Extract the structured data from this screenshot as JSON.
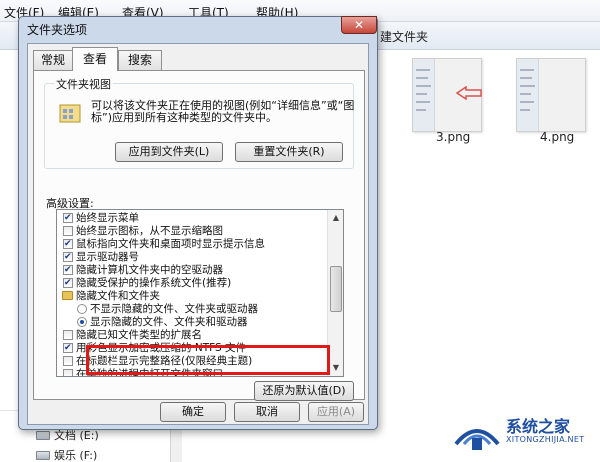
{
  "explorer": {
    "menu": [
      "文件(F)",
      "编辑(E)",
      "查看(V)",
      "工具(T)",
      "帮助(H)"
    ],
    "new_folder_label": "建文件夹",
    "files": [
      {
        "name": "3.png",
        "icon": "image-thumbnail"
      },
      {
        "name": "4.png",
        "icon": "image-thumbnail"
      }
    ],
    "drives": [
      {
        "label": "文档 (E:)",
        "icon": "drive-icon"
      },
      {
        "label": "娱乐 (F:)",
        "icon": "drive-icon"
      }
    ]
  },
  "dialog": {
    "title": "文件夹选项",
    "close_label": "✕",
    "tabs": [
      {
        "label": "常规",
        "active": false
      },
      {
        "label": "查看",
        "active": true
      },
      {
        "label": "搜索",
        "active": false
      }
    ],
    "folder_views": {
      "group_label": "文件夹视图",
      "description": "可以将该文件夹正在使用的视图(例如“详细信息”或“图标”)应用到所有这种类型的文件夹中。",
      "apply_button": "应用到文件夹(L)",
      "reset_button": "重置文件夹(R)"
    },
    "advanced_label": "高级设置:",
    "advanced_items": [
      {
        "type": "checkbox",
        "checked": true,
        "label": "始终显示菜单"
      },
      {
        "type": "checkbox",
        "checked": false,
        "label": "始终显示图标，从不显示缩略图"
      },
      {
        "type": "checkbox",
        "checked": true,
        "label": "鼠标指向文件夹和桌面项时显示提示信息"
      },
      {
        "type": "checkbox",
        "checked": true,
        "label": "显示驱动器号"
      },
      {
        "type": "checkbox",
        "checked": true,
        "label": "隐藏计算机文件夹中的空驱动器"
      },
      {
        "type": "checkbox",
        "checked": true,
        "label": "隐藏受保护的操作系统文件(推荐)"
      },
      {
        "type": "folder",
        "label": "隐藏文件和文件夹"
      },
      {
        "type": "radio",
        "checked": false,
        "label": "不显示隐藏的文件、文件夹或驱动器"
      },
      {
        "type": "radio",
        "checked": true,
        "label": "显示隐藏的文件、文件夹和驱动器"
      },
      {
        "type": "checkbox",
        "checked": false,
        "label": "隐藏已知文件类型的扩展名"
      },
      {
        "type": "checkbox",
        "checked": true,
        "label": "用彩色显示加密或压缩的 NTFS 文件"
      },
      {
        "type": "checkbox",
        "checked": false,
        "label": "在标题栏显示完整路径(仅限经典主题)"
      },
      {
        "type": "checkbox",
        "checked": false,
        "label": "在单独的进程中打开文件夹窗口"
      }
    ],
    "restore_defaults": "还原为默认值(D)",
    "ok": "确定",
    "cancel": "取消",
    "apply": "应用(A)"
  },
  "watermark": {
    "name": "系统之家",
    "url": "XITONGZHIJIA.NET"
  },
  "colors": {
    "highlight": "#e01919",
    "accent": "#1f4fa0"
  }
}
